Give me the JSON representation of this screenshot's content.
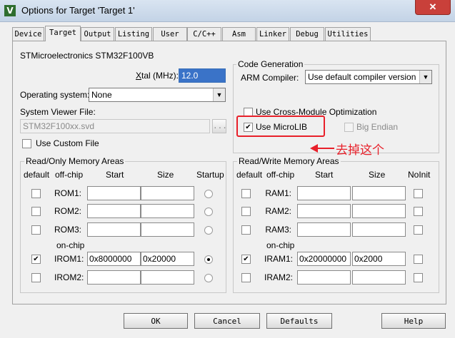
{
  "window": {
    "app_icon": "V",
    "title": "Options for Target 'Target 1'",
    "close": "✕"
  },
  "tabs": [
    "Device",
    "Target",
    "Output",
    "Listing",
    "User",
    "C/C++",
    "Asm",
    "Linker",
    "Debug",
    "Utilities"
  ],
  "active_tab": "Target",
  "device_name": "STMicroelectronics STM32F100VB",
  "xtal": {
    "label": "Xtal (MHz):",
    "value": "12.0"
  },
  "os": {
    "label": "Operating system:",
    "value": "None"
  },
  "svd": {
    "label": "System Viewer File:",
    "value": "STM32F100xx.svd",
    "browse": "..."
  },
  "custom_file": {
    "label": "Use Custom File",
    "checked": false
  },
  "code_gen": {
    "title": "Code Generation",
    "compiler_label": "ARM Compiler:",
    "compiler_value": "Use default compiler version",
    "cross_module": {
      "label": "Use Cross-Module Optimization",
      "checked": false
    },
    "microlib": {
      "label": "Use MicroLIB",
      "checked": true
    },
    "big_endian": {
      "label": "Big Endian",
      "checked": false
    }
  },
  "annotation": {
    "text": "去掉这个",
    "color": "#e8202a"
  },
  "rom": {
    "title": "Read/Only Memory Areas",
    "headers": {
      "default": "default",
      "offchip": "off-chip",
      "start": "Start",
      "size": "Size",
      "extra": "Startup"
    },
    "onchip_label": "on-chip",
    "rows": [
      {
        "name": "ROM1:",
        "default": false,
        "start": "",
        "size": "",
        "selected": false
      },
      {
        "name": "ROM2:",
        "default": false,
        "start": "",
        "size": "",
        "selected": false
      },
      {
        "name": "ROM3:",
        "default": false,
        "start": "",
        "size": "",
        "selected": false
      },
      {
        "name": "IROM1:",
        "default": true,
        "start": "0x8000000",
        "size": "0x20000",
        "selected": true
      },
      {
        "name": "IROM2:",
        "default": false,
        "start": "",
        "size": "",
        "selected": false
      }
    ]
  },
  "ram": {
    "title": "Read/Write Memory Areas",
    "headers": {
      "default": "default",
      "offchip": "off-chip",
      "start": "Start",
      "size": "Size",
      "extra": "NoInit"
    },
    "onchip_label": "on-chip",
    "rows": [
      {
        "name": "RAM1:",
        "default": false,
        "start": "",
        "size": "",
        "noinit": false
      },
      {
        "name": "RAM2:",
        "default": false,
        "start": "",
        "size": "",
        "noinit": false
      },
      {
        "name": "RAM3:",
        "default": false,
        "start": "",
        "size": "",
        "noinit": false
      },
      {
        "name": "IRAM1:",
        "default": true,
        "start": "0x20000000",
        "size": "0x2000",
        "noinit": false
      },
      {
        "name": "IRAM2:",
        "default": false,
        "start": "",
        "size": "",
        "noinit": false
      }
    ]
  },
  "buttons": {
    "ok": "OK",
    "cancel": "Cancel",
    "defaults": "Defaults",
    "help": "Help"
  }
}
